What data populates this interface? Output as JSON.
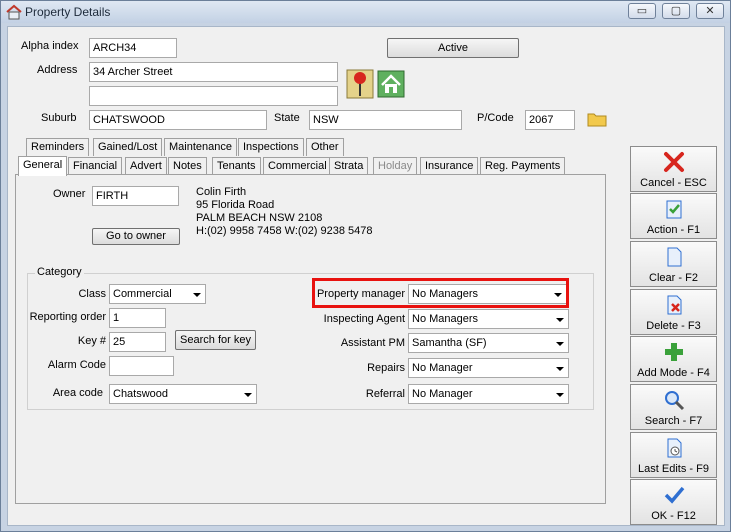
{
  "window": {
    "title": "Property Details",
    "controls": {
      "minimize": "▭",
      "restore": "▢",
      "close": "✕"
    }
  },
  "header": {
    "alpha_index": {
      "label": "Alpha index",
      "value": "ARCH34"
    },
    "status_button": "Active",
    "address": {
      "label": "Address",
      "line1": "34 Archer Street",
      "line2": ""
    },
    "suburb": {
      "label": "Suburb",
      "value": "CHATSWOOD"
    },
    "state": {
      "label": "State",
      "value": "NSW"
    },
    "postcode": {
      "label": "P/Code",
      "value": "2067"
    }
  },
  "tabs_row1": [
    "Reminders",
    "Gained/Lost",
    "Maintenance",
    "Inspections",
    "Other"
  ],
  "tabs_row2": [
    "General",
    "Financial",
    "Advert",
    "Notes",
    "Tenants",
    "Commercial",
    "Strata",
    "Holday",
    "Insurance",
    "Reg. Payments"
  ],
  "general": {
    "owner": {
      "label": "Owner",
      "value": "FIRTH",
      "name": "Colin Firth",
      "address1": "95 Florida Road",
      "address2": "PALM BEACH NSW 2108",
      "phones": "H:(02) 9958 7458  W:(02) 9238 5478",
      "goto_button": "Go to owner"
    },
    "category": {
      "title": "Category",
      "class": {
        "label": "Class",
        "value": "Commercial"
      },
      "reporting_order": {
        "label": "Reporting order",
        "value": "1"
      },
      "key": {
        "label": "Key #",
        "value": "25",
        "search_button": "Search for key"
      },
      "alarm_code": {
        "label": "Alarm Code",
        "value": ""
      },
      "area_code": {
        "label": "Area code",
        "value": "Chatswood"
      },
      "property_manager": {
        "label": "Property manager",
        "value": "No Managers"
      },
      "inspecting_agent": {
        "label": "Inspecting Agent",
        "value": "No Managers"
      },
      "assistant_pm": {
        "label": "Assistant PM",
        "value": "Samantha  (SF)"
      },
      "repairs": {
        "label": "Repairs",
        "value": "No Manager"
      },
      "referral": {
        "label": "Referral",
        "value": "No Manager"
      }
    }
  },
  "side_buttons": [
    {
      "label": "Cancel - ESC",
      "icon": "cancel-x-icon"
    },
    {
      "label": "Action - F1",
      "icon": "clipboard-check-icon"
    },
    {
      "label": "Clear - F2",
      "icon": "blank-page-icon"
    },
    {
      "label": "Delete - F3",
      "icon": "delete-page-icon"
    },
    {
      "label": "Add Mode - F4",
      "icon": "plus-icon"
    },
    {
      "label": "Search - F7",
      "icon": "magnifier-icon"
    },
    {
      "label": "Last Edits - F9",
      "icon": "history-page-icon"
    },
    {
      "label": "OK - F12",
      "icon": "checkmark-icon"
    }
  ],
  "colors": {
    "highlight": "#e8120f",
    "accent_green": "#3aa13a",
    "accent_red": "#d7261e",
    "accent_blue": "#2f6fd1"
  }
}
